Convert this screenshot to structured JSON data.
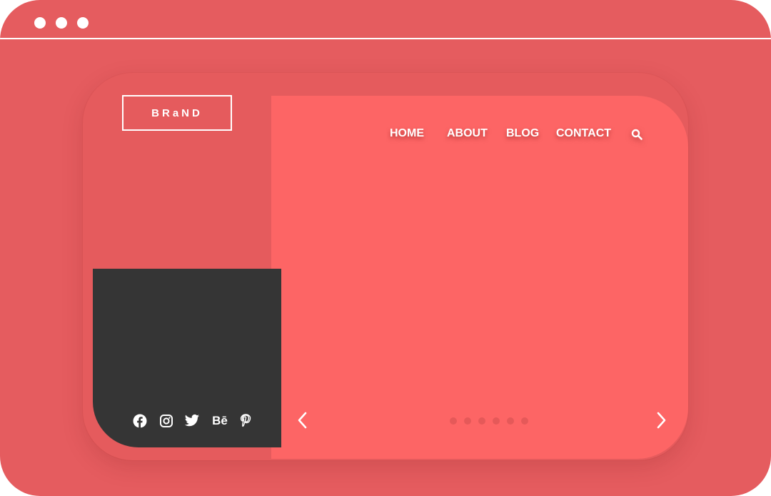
{
  "window": {
    "controls": [
      "dot",
      "dot",
      "dot"
    ]
  },
  "brand": {
    "logo_text": "BRaND"
  },
  "nav": {
    "items": [
      {
        "label": "HOME"
      },
      {
        "label": "ABOUT"
      },
      {
        "label": "BLOG"
      },
      {
        "label": "CONTACT"
      }
    ],
    "search_icon": "search-icon"
  },
  "social": {
    "icons": [
      "facebook-icon",
      "instagram-icon",
      "twitter-icon",
      "behance-icon",
      "pinterest-icon"
    ],
    "behance_text": "Bē"
  },
  "slider": {
    "prev_icon": "chevron-left-icon",
    "next_icon": "chevron-right-icon",
    "slide_count": 6,
    "active_index": 0
  },
  "colors": {
    "background": "#e55c5f",
    "hero": "#fd6565",
    "panel": "#353535",
    "text": "#ffffff"
  }
}
